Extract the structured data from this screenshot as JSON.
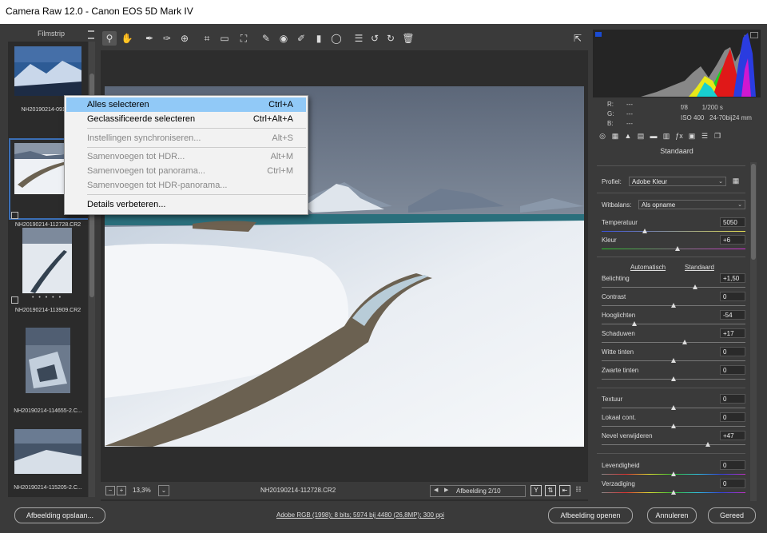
{
  "window": {
    "title": "Camera Raw 12.0  -  Canon EOS 5D Mark IV"
  },
  "filmstrip": {
    "header": "Filmstrip",
    "items": [
      {
        "name": "NH20190214-091605"
      },
      {
        "name": "NH20190214-112728.CR2"
      },
      {
        "name": "NH20190214-113909.CR2"
      },
      {
        "name": "NH20190214-114655-2.C..."
      },
      {
        "name": "NH20190214-115205-2.C..."
      }
    ]
  },
  "toolbar": {
    "tools": [
      "zoom-tool-icon",
      "hand-tool-icon",
      "white-balance-icon",
      "color-sampler-icon",
      "target-adjust-icon",
      "crop-icon",
      "straighten-icon",
      "transform-icon",
      "spot-removal-icon",
      "red-eye-icon",
      "adjustment-brush-icon",
      "graduated-filter-icon",
      "radial-filter-icon",
      "preferences-icon",
      "rotate-left-icon",
      "rotate-right-icon",
      "trash-icon"
    ],
    "fullscreen_icon": "fullscreen-icon"
  },
  "context_menu": {
    "items": [
      {
        "label": "Alles selecteren",
        "shortcut": "Ctrl+A",
        "state": "highlighted"
      },
      {
        "label": "Geclassificeerde selecteren",
        "shortcut": "Ctrl+Alt+A",
        "state": "enabled"
      },
      {
        "label": "Instellingen synchroniseren...",
        "shortcut": "Alt+S",
        "state": "disabled"
      },
      {
        "label": "Samenvoegen tot HDR...",
        "shortcut": "Alt+M",
        "state": "disabled"
      },
      {
        "label": "Samenvoegen tot panorama...",
        "shortcut": "Ctrl+M",
        "state": "disabled"
      },
      {
        "label": "Samenvoegen tot HDR-panorama...",
        "shortcut": "",
        "state": "disabled"
      },
      {
        "label": "Details verbeteren...",
        "shortcut": "",
        "state": "enabled"
      }
    ]
  },
  "status": {
    "zoom": "13,3%",
    "filename": "NH20190214-112728.CR2",
    "image_counter": "Afbeelding 2/10"
  },
  "histogram": {
    "rgb_labels": [
      "R:",
      "G:",
      "B:"
    ],
    "rgb_values": [
      "---",
      "---",
      "---"
    ],
    "aperture": "f/8",
    "shutter": "1/200 s",
    "iso": "ISO 400",
    "lens": "24-70bij24 mm"
  },
  "panel": {
    "title": "Standaard",
    "profile_label": "Profiel:",
    "profile_value": "Adobe Kleur",
    "wb_label": "Witbalans:",
    "wb_value": "Als opname",
    "auto_link": "Automatisch",
    "default_link": "Standaard",
    "sliders": [
      {
        "label": "Temperatuur",
        "value": "5050",
        "pos": 0.3
      },
      {
        "label": "Kleur",
        "value": "+6",
        "pos": 0.53
      },
      {
        "label": "Belichting",
        "value": "+1,50",
        "pos": 0.65
      },
      {
        "label": "Contrast",
        "value": "0",
        "pos": 0.5
      },
      {
        "label": "Hooglichten",
        "value": "-54",
        "pos": 0.23
      },
      {
        "label": "Schaduwen",
        "value": "+17",
        "pos": 0.58
      },
      {
        "label": "Witte tinten",
        "value": "0",
        "pos": 0.5
      },
      {
        "label": "Zwarte tinten",
        "value": "0",
        "pos": 0.5
      },
      {
        "label": "Textuur",
        "value": "0",
        "pos": 0.5
      },
      {
        "label": "Lokaal cont.",
        "value": "0",
        "pos": 0.5
      },
      {
        "label": "Nevel verwijderen",
        "value": "+47",
        "pos": 0.74
      },
      {
        "label": "Levendigheid",
        "value": "0",
        "pos": 0.5
      },
      {
        "label": "Verzadiging",
        "value": "0",
        "pos": 0.5
      }
    ]
  },
  "bottom": {
    "save": "Afbeelding opslaan...",
    "workflow": "Adobe RGB (1998); 8 bits; 5974 bij 4480 (26,8MP); 300 ppi",
    "open": "Afbeelding openen",
    "cancel": "Annuleren",
    "done": "Gereed"
  }
}
